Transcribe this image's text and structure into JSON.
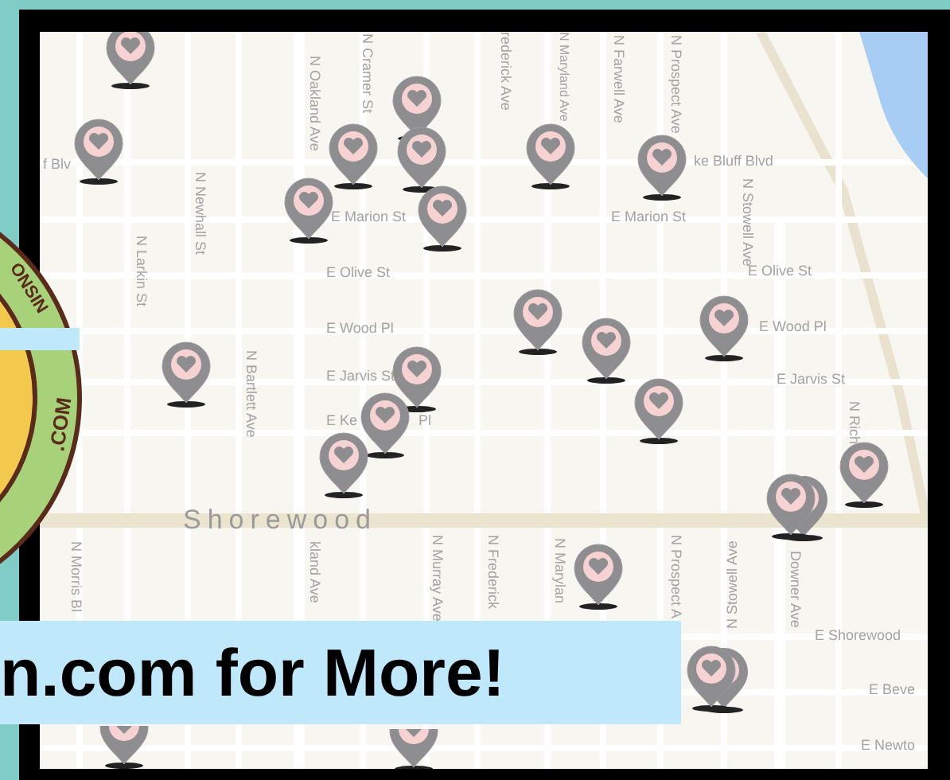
{
  "map": {
    "streets": [
      "N Oakland Ave",
      "N Cramer St",
      "rederick Ave",
      "N Maryland Ave",
      "N Farwell Ave",
      "N Prospect Ave",
      "f Blv",
      "ke Bluff Blvd",
      "E Marion St",
      "E Marion St",
      "N Newhall St",
      "N Larkin St",
      "N Stowell Ave",
      "E Olive St",
      "E Olive St",
      "E Wood Pl",
      "E Wood Pl",
      "E Jarvis St",
      "E Jarvis St",
      "N Bartlett Ave",
      "E Ke",
      "Pl",
      "N Rich",
      "N Morris Bl",
      "kland Ave",
      "N Murray Ave",
      "N Frederick",
      "N Marylan",
      "N Prospect A",
      "N Stowell Ave",
      "Downer Ave",
      "E Shorewood",
      "E Beve",
      "E Newto"
    ],
    "place_label": "Shorewood"
  },
  "badge": {
    "texts": [
      "ONSIN",
      ".COM"
    ]
  },
  "banner": {
    "text": "n.com for More!"
  }
}
